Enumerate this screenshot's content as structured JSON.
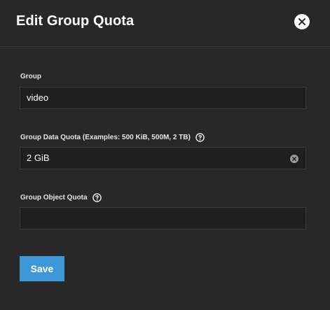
{
  "dialog": {
    "title": "Edit Group Quota",
    "close_icon": "close-circle-icon"
  },
  "fields": {
    "group": {
      "label": "Group",
      "value": "video"
    },
    "data_quota": {
      "label": "Group Data Quota (Examples: 500 KiB, 500M, 2 TB)",
      "value": "2 GiB",
      "help_icon": "help-circle-icon",
      "clear_icon": "clear-circle-icon"
    },
    "object_quota": {
      "label": "Group Object Quota",
      "value": "",
      "help_icon": "help-circle-icon"
    }
  },
  "actions": {
    "save_label": "Save"
  },
  "colors": {
    "background": "#282828",
    "input_background": "#1f1f1f",
    "primary": "#3e98d8",
    "text": "#ffffff"
  }
}
